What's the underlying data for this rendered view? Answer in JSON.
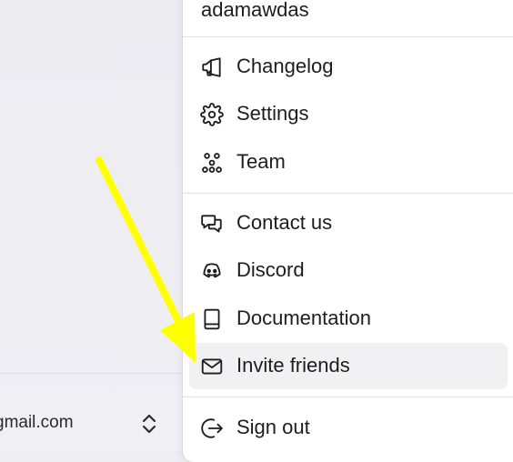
{
  "background": {
    "email_partial": "gmail.com"
  },
  "menu": {
    "username": "adamawdas",
    "items": [
      {
        "label": "Changelog",
        "icon": "megaphone-icon"
      },
      {
        "label": "Settings",
        "icon": "gear-icon"
      },
      {
        "label": "Team",
        "icon": "team-icon"
      },
      {
        "label": "Contact us",
        "icon": "chat-bubbles-icon"
      },
      {
        "label": "Discord",
        "icon": "discord-icon"
      },
      {
        "label": "Documentation",
        "icon": "book-icon"
      },
      {
        "label": "Invite friends",
        "icon": "envelope-icon",
        "highlighted": true
      },
      {
        "label": "Sign out",
        "icon": "sign-out-icon"
      }
    ]
  },
  "annotation": {
    "arrow_color": "#ffff00",
    "points_to": "Invite friends"
  }
}
